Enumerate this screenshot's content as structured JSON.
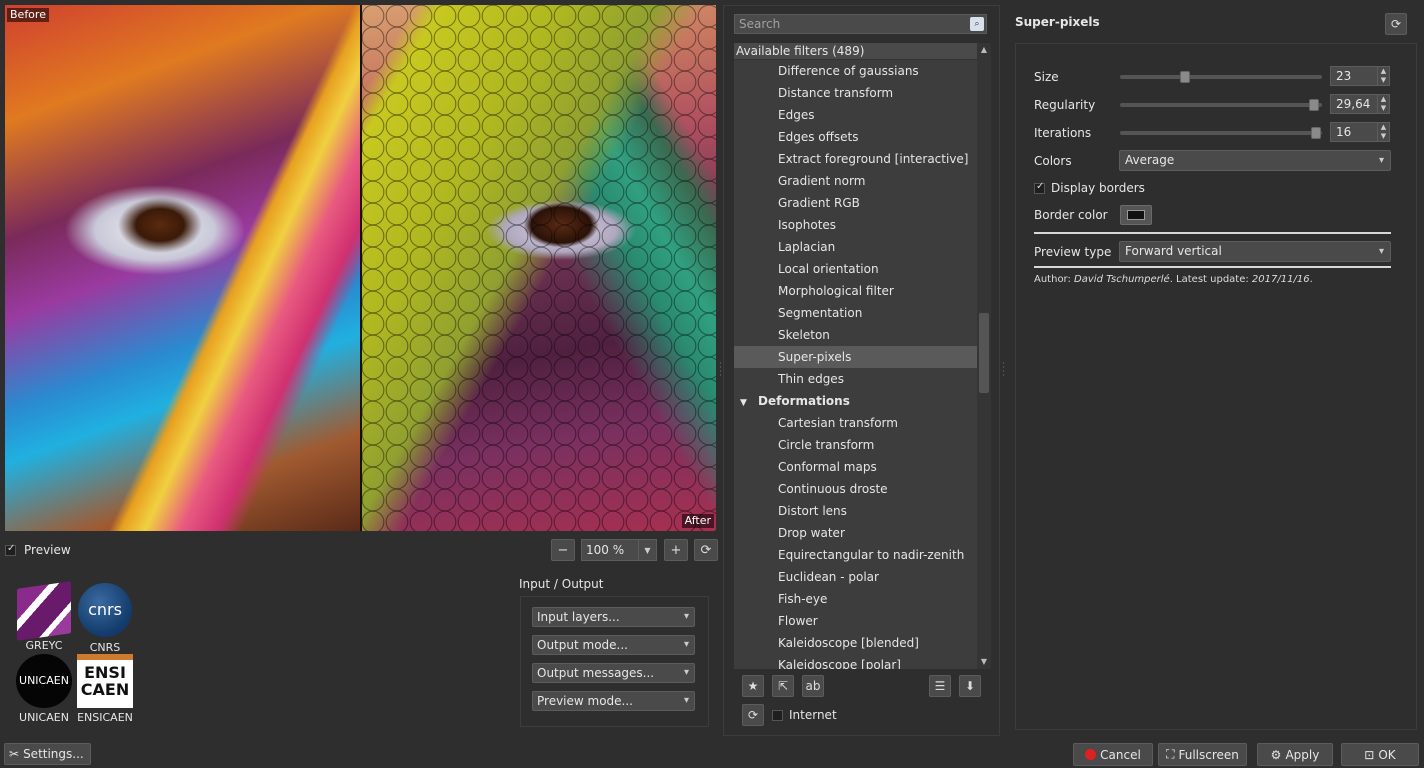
{
  "preview": {
    "before_label": "Before",
    "after_label": "After",
    "preview_toggle_label": "Preview",
    "preview_checked": true,
    "zoom_value": "100 %"
  },
  "logos": {
    "greyc": "GREYC",
    "cnrs": "CNRS",
    "cnrs_mark": "cnrs",
    "unicaen": "UNICAEN",
    "unicaen_mark": "UNICAEN",
    "ensicaen": "ENSICAEN",
    "ensicaen_mark_1": "ENSI",
    "ensicaen_mark_2": "CAEN"
  },
  "io": {
    "title": "Input / Output",
    "input_layers": "Input layers...",
    "output_mode": "Output mode...",
    "output_messages": "Output messages...",
    "preview_mode": "Preview mode..."
  },
  "settings_button": "Settings...",
  "filters": {
    "search_placeholder": "Search",
    "available_label": "Available filters (489)",
    "items": [
      {
        "label": "Difference of gaussians"
      },
      {
        "label": "Distance transform"
      },
      {
        "label": "Edges"
      },
      {
        "label": "Edges offsets"
      },
      {
        "label": "Extract foreground [interactive]"
      },
      {
        "label": "Gradient norm"
      },
      {
        "label": "Gradient RGB"
      },
      {
        "label": "Isophotes"
      },
      {
        "label": "Laplacian"
      },
      {
        "label": "Local orientation"
      },
      {
        "label": "Morphological filter"
      },
      {
        "label": "Segmentation"
      },
      {
        "label": "Skeleton"
      },
      {
        "label": "Super-pixels"
      },
      {
        "label": "Thin edges"
      }
    ],
    "category": "Deformations",
    "category_items": [
      {
        "label": "Cartesian transform"
      },
      {
        "label": "Circle transform"
      },
      {
        "label": "Conformal maps"
      },
      {
        "label": "Continuous droste"
      },
      {
        "label": "Distort lens"
      },
      {
        "label": "Drop water"
      },
      {
        "label": "Equirectangular to nadir-zenith"
      },
      {
        "label": "Euclidean - polar"
      },
      {
        "label": "Fish-eye"
      },
      {
        "label": "Flower"
      },
      {
        "label": "Kaleidoscope [blended]"
      },
      {
        "label": "Kaleidoscope [polar]"
      }
    ],
    "internet_label": "Internet",
    "internet_checked": false
  },
  "filter_settings": {
    "title": "Super-pixels",
    "size_label": "Size",
    "size_value": "23",
    "size_fraction": 0.32,
    "regularity_label": "Regularity",
    "regularity_value": "29,64",
    "regularity_fraction": 0.96,
    "iterations_label": "Iterations",
    "iterations_value": "16",
    "iterations_fraction": 0.97,
    "colors_label": "Colors",
    "colors_value": "Average",
    "display_borders_label": "Display borders",
    "display_borders_checked": true,
    "border_color_label": "Border color",
    "preview_type_label": "Preview type",
    "preview_type_value": "Forward vertical",
    "author_prefix": "Author: ",
    "author_name": "David Tschumperlé",
    "update_prefix": ". Latest update: ",
    "update_date": "2017/11/16",
    "update_suffix": "."
  },
  "buttons": {
    "cancel": "Cancel",
    "fullscreen": "Fullscreen",
    "apply": "Apply",
    "ok": "OK"
  }
}
